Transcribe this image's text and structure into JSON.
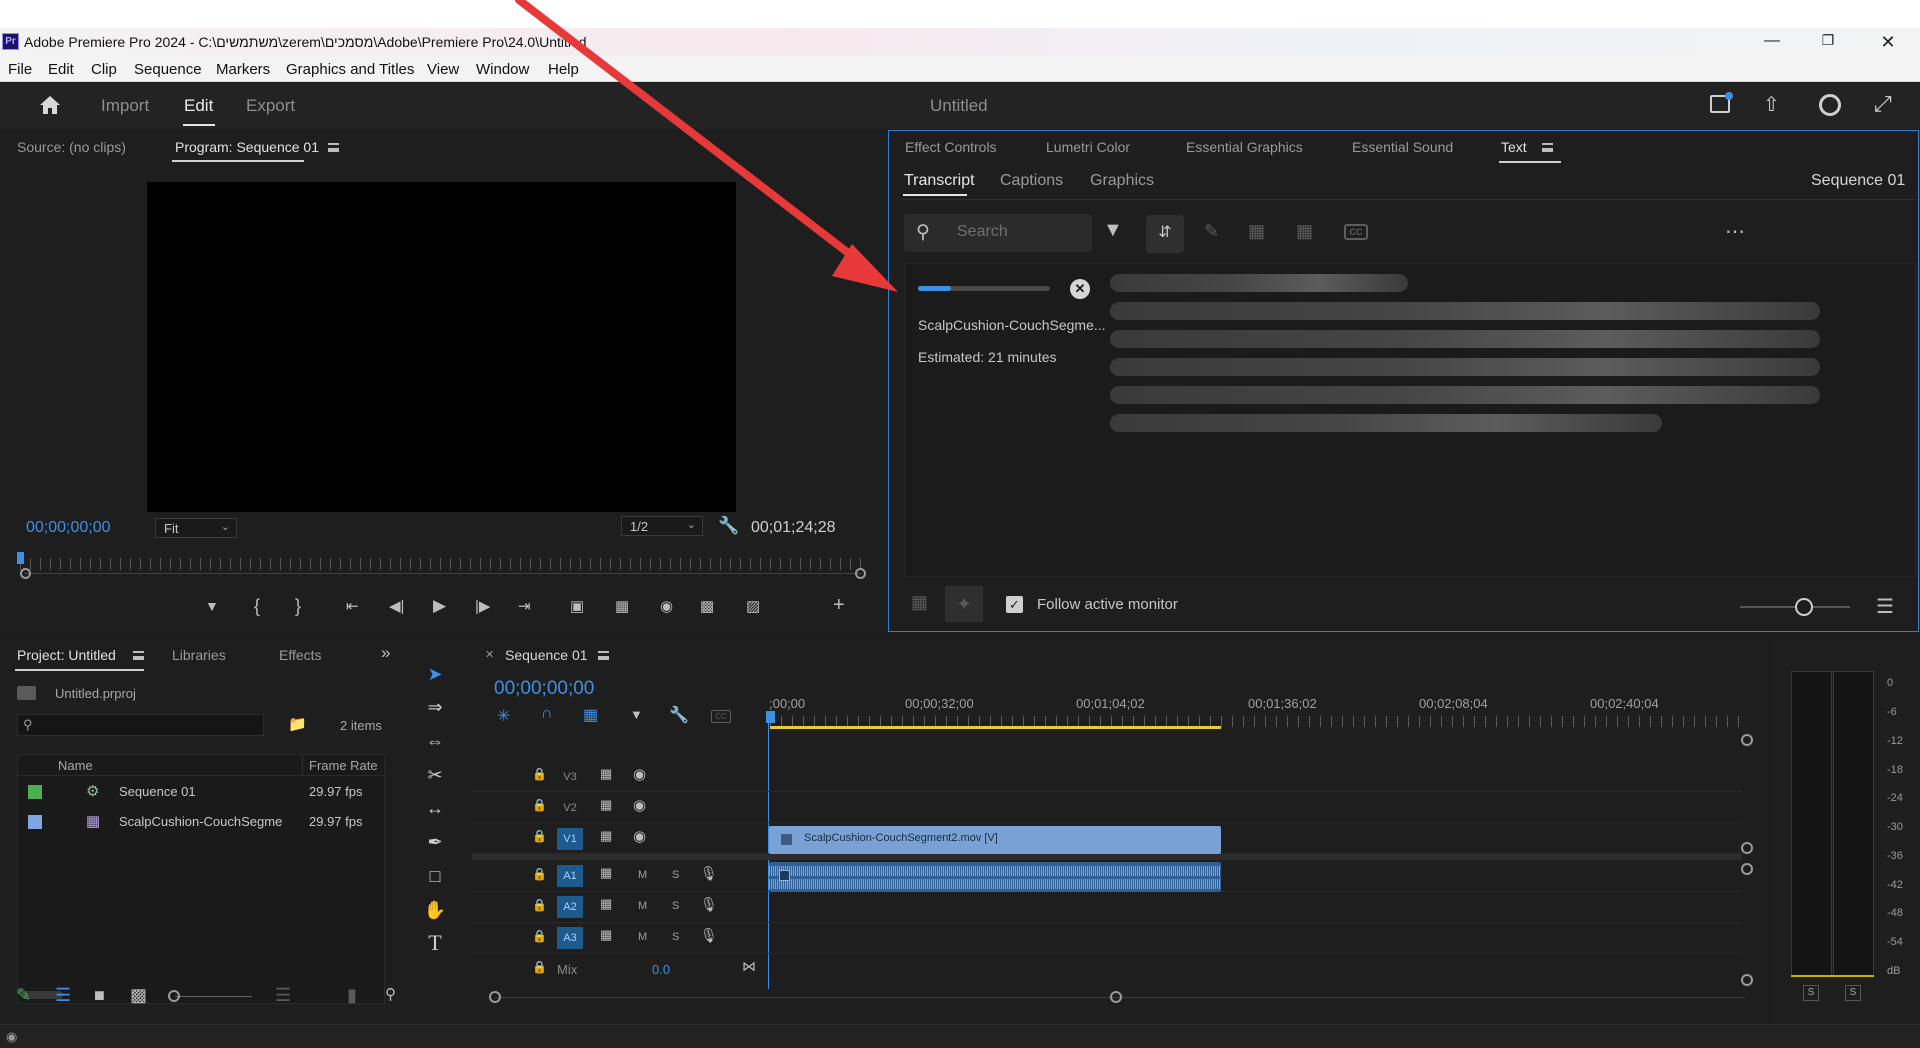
{
  "titlebar": {
    "app_icon": "Pr",
    "title": "Adobe Premiere Pro 2024 - C:\\משתמשים\\zerem\\מסמכים\\Adobe\\Premiere Pro\\24.0\\Untitled",
    "controls": [
      "minimize-icon",
      "restore-icon",
      "close-icon"
    ]
  },
  "menubar": {
    "items": [
      "File",
      "Edit",
      "Clip",
      "Sequence",
      "Markers",
      "Graphics and Titles",
      "View",
      "Window",
      "Help"
    ]
  },
  "header": {
    "home_icon": "home-icon",
    "tabs": [
      "Import",
      "Edit",
      "Export"
    ],
    "active_tab": "Edit",
    "project_title": "Untitled",
    "right_icons": [
      "quick-export-icon",
      "share-icon",
      "progress-icon",
      "fullscreen-icon"
    ]
  },
  "monitor": {
    "source_tab": "Source: (no clips)",
    "program_tab": "Program: Sequence 01",
    "current_time": "00;00;00;00",
    "fit": "Fit",
    "resolution": "1/2",
    "duration": "00;01;24;28"
  },
  "text_panel": {
    "tabs": [
      "Effect Controls",
      "Lumetri Color",
      "Essential Graphics",
      "Essential Sound",
      "Text"
    ],
    "active_tab": "Text",
    "subtabs": [
      "Transcript",
      "Captions",
      "Graphics"
    ],
    "active_subtab": "Transcript",
    "sequence_name": "Sequence 01",
    "search_placeholder": "Search",
    "progress": 0.25,
    "clip_name": "ScalpCushion-CouchSegme...",
    "estimated": "Estimated: 21 minutes",
    "follow_label": "Follow active monitor",
    "follow_checked": true
  },
  "project": {
    "tabs": [
      "Project: Untitled",
      "Libraries",
      "Effects"
    ],
    "file_name": "Untitled.prproj",
    "item_count": "2 items",
    "columns": [
      "Name",
      "Frame Rate"
    ],
    "rows": [
      {
        "name": "Sequence 01",
        "rate": "29.97 fps",
        "color": "#4caf50",
        "icon": "sequence-icon"
      },
      {
        "name": "ScalpCushion-CouchSegme",
        "rate": "29.97 fps",
        "color": "#7ea6e0",
        "icon": "clip-icon"
      }
    ]
  },
  "timeline": {
    "tab": "Sequence 01",
    "current_time": "00;00;00;00",
    "timestamps": [
      ";00;00",
      "00;00;32;00",
      "00;01;04;02",
      "00;01;36;02",
      "00;02;08;04",
      "00;02;40;04"
    ],
    "video_tracks": [
      "V3",
      "V2",
      "V1"
    ],
    "audio_tracks": [
      "A1",
      "A2",
      "A3"
    ],
    "track_buttons": [
      "M",
      "S"
    ],
    "mix_label": "Mix",
    "mix_value": "0.0",
    "video_clip": "ScalpCushion-CouchSegment2.mov [V]"
  },
  "meter": {
    "labels": [
      "0",
      "-6",
      "-12",
      "-18",
      "-24",
      "-30",
      "-36",
      "-42",
      "-48",
      "-54",
      "dB"
    ],
    "solo_buttons": [
      "S",
      "S"
    ]
  },
  "colors": {
    "accent_blue": "#3e8fe6",
    "clip_blue": "#7aa1d3",
    "track_on": "#1d5a8e",
    "arrow_red": "#e8393a"
  }
}
